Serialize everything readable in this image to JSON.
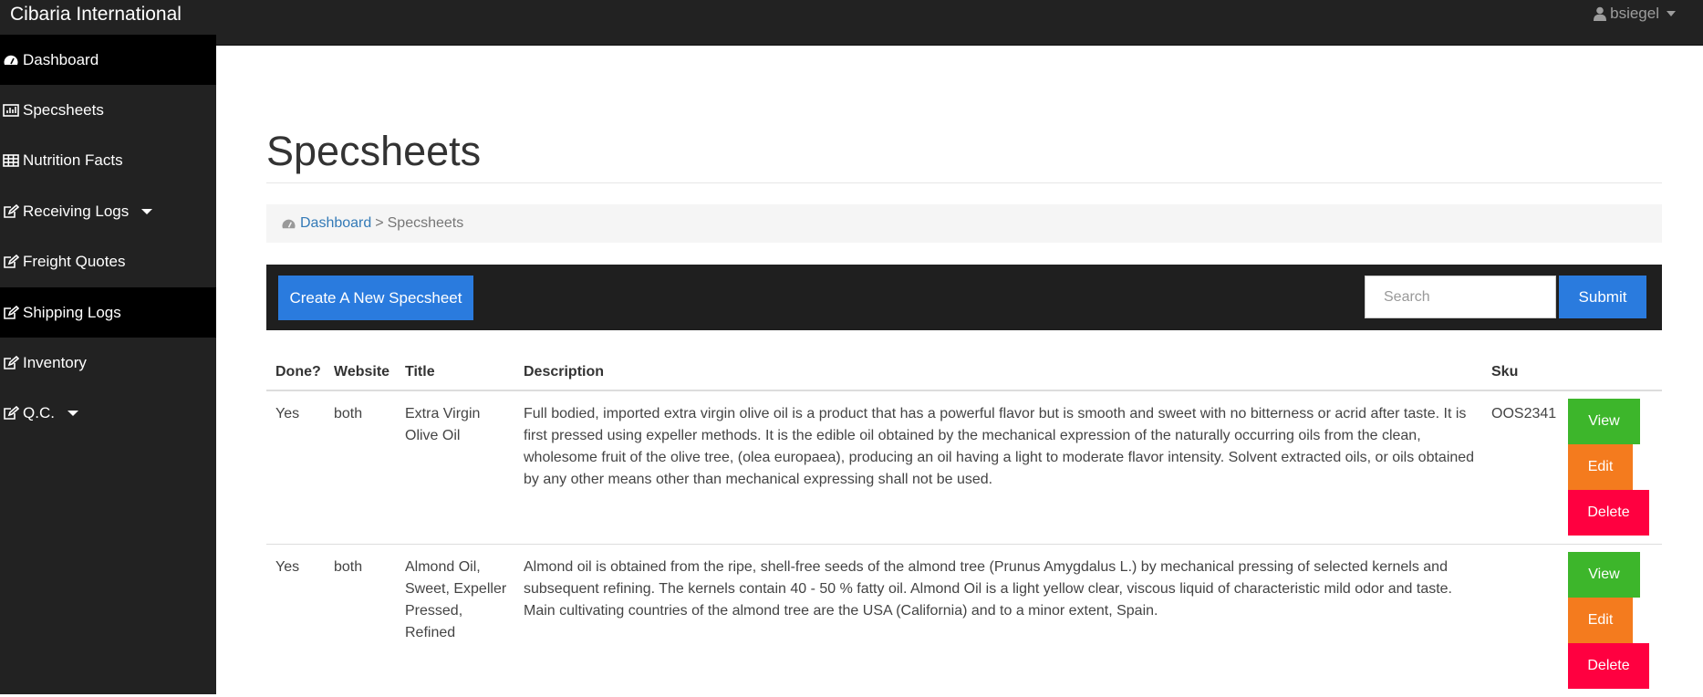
{
  "app": {
    "brand": "Cibaria International",
    "user": "bsiegel"
  },
  "sidebar": {
    "items": [
      {
        "label": "Dashboard",
        "icon": "dashboard-icon"
      },
      {
        "label": "Specsheets",
        "icon": "bar-chart-icon"
      },
      {
        "label": "Nutrition Facts",
        "icon": "table-icon"
      },
      {
        "label": "Receiving Logs",
        "icon": "edit-icon"
      },
      {
        "label": "Freight Quotes",
        "icon": "edit-icon"
      },
      {
        "label": "Shipping Logs",
        "icon": "edit-icon"
      },
      {
        "label": "Inventory",
        "icon": "edit-icon"
      },
      {
        "label": "Q.C.",
        "icon": "edit-icon"
      }
    ]
  },
  "page": {
    "title": "Specsheets"
  },
  "breadcrumb": {
    "home": "Dashboard",
    "separator": ">",
    "current": "Specsheets"
  },
  "toolbar": {
    "create_label": "Create A New Specsheet",
    "search_placeholder": "Search",
    "submit_label": "Submit"
  },
  "table": {
    "headers": {
      "done": "Done?",
      "website": "Website",
      "title": "Title",
      "description": "Description",
      "sku": "Sku"
    },
    "rows": [
      {
        "done": "Yes",
        "website": "both",
        "title": "Extra Virgin Olive Oil",
        "description": "Full bodied, imported extra virgin olive oil is a product that has a powerful flavor but is smooth and sweet with no bitterness or acrid after taste. It is first pressed using expeller methods. It is the edible oil obtained by the mechanical expression of the naturally occurring oils from the clean, wholesome fruit of the olive tree, (olea europaea), producing an oil having a light to moderate flavor intensity. Solvent extracted oils, or oils obtained by any other means other than mechanical expressing shall not be used.",
        "sku": "OOS2341"
      },
      {
        "done": "Yes",
        "website": "both",
        "title": "Almond Oil, Sweet, Expeller Pressed, Refined",
        "description": "Almond oil is obtained from the ripe, shell-free seeds of the almond tree (Prunus Amygdalus L.) by mechanical pressing of selected kernels and subsequent refining. The kernels contain 40 - 50 % fatty oil. Almond Oil is a light yellow clear, viscous liquid of characteristic mild odor and taste. Main cultivating countries of the almond tree are the USA (California) and to a minor extent, Spain.",
        "sku": ""
      }
    ],
    "actions": {
      "view": "View",
      "edit": "Edit",
      "delete": "Delete"
    }
  },
  "colors": {
    "topbar": "#222222",
    "primary": "#2a7bde",
    "view": "#3db62b",
    "edit": "#f47b1e",
    "delete": "#ff0040",
    "link": "#337ab7"
  }
}
